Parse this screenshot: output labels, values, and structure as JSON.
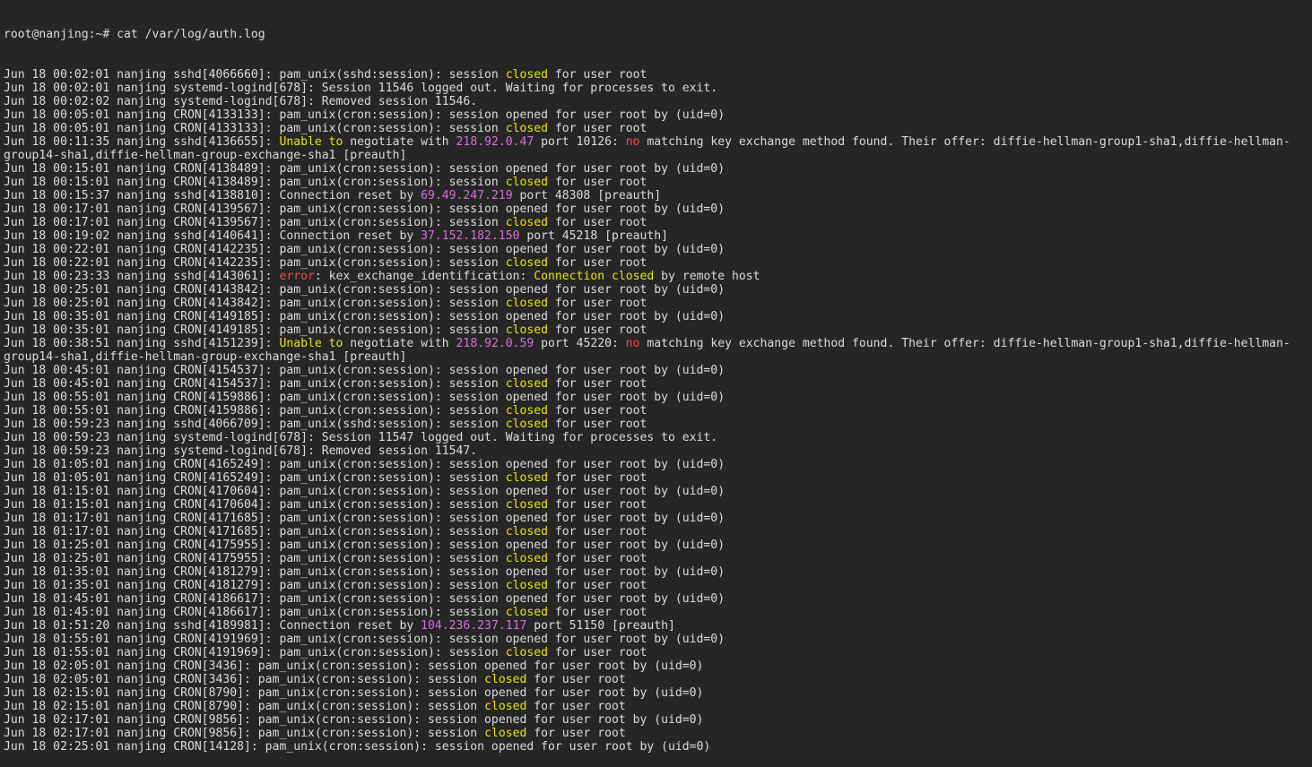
{
  "terminal": {
    "prompt": "root@nanjing:~# ",
    "command": "cat /var/log/auth.log",
    "colors": {
      "background": "#262626",
      "text": "#dcdcdc",
      "keyword_closed": "#e5e510",
      "ip_address": "#d670d6",
      "error": "#f14c4c"
    },
    "lines": [
      [
        {
          "t": "Jun 18 00:02:01 nanjing sshd[4066660]: pam_unix(sshd:session): session "
        },
        {
          "t": "closed",
          "c": "closed"
        },
        {
          "t": " for user root"
        }
      ],
      [
        {
          "t": "Jun 18 00:02:01 nanjing systemd-logind[678]: Session 11546 logged out. Waiting for processes to exit."
        }
      ],
      [
        {
          "t": "Jun 18 00:02:02 nanjing systemd-logind[678]: Removed session 11546."
        }
      ],
      [
        {
          "t": "Jun 18 00:05:01 nanjing CRON[4133133]: pam_unix(cron:session): session opened for user root by (uid=0)"
        }
      ],
      [
        {
          "t": "Jun 18 00:05:01 nanjing CRON[4133133]: pam_unix(cron:session): session "
        },
        {
          "t": "closed",
          "c": "closed"
        },
        {
          "t": " for user root"
        }
      ],
      [
        {
          "t": "Jun 18 00:11:35 nanjing sshd[4136655]: "
        },
        {
          "t": "Unable to",
          "c": "warn"
        },
        {
          "t": " negotiate with "
        },
        {
          "t": "218.92.0.47",
          "c": "ip"
        },
        {
          "t": " port 10126: "
        },
        {
          "t": "no",
          "c": "err"
        },
        {
          "t": " matching key exchange method found. Their offer: diffie-hellman-group1-sha1,diffie-hellman-"
        }
      ],
      [
        {
          "t": "group14-sha1,diffie-hellman-group-exchange-sha1 [preauth]"
        }
      ],
      [
        {
          "t": "Jun 18 00:15:01 nanjing CRON[4138489]: pam_unix(cron:session): session opened for user root by (uid=0)"
        }
      ],
      [
        {
          "t": "Jun 18 00:15:01 nanjing CRON[4138489]: pam_unix(cron:session): session "
        },
        {
          "t": "closed",
          "c": "closed"
        },
        {
          "t": " for user root"
        }
      ],
      [
        {
          "t": "Jun 18 00:15:37 nanjing sshd[4138810]: Connection reset by "
        },
        {
          "t": "69.49.247.219",
          "c": "ip"
        },
        {
          "t": " port 48308 [preauth]"
        }
      ],
      [
        {
          "t": "Jun 18 00:17:01 nanjing CRON[4139567]: pam_unix(cron:session): session opened for user root by (uid=0)"
        }
      ],
      [
        {
          "t": "Jun 18 00:17:01 nanjing CRON[4139567]: pam_unix(cron:session): session "
        },
        {
          "t": "closed",
          "c": "closed"
        },
        {
          "t": " for user root"
        }
      ],
      [
        {
          "t": "Jun 18 00:19:02 nanjing sshd[4140641]: Connection reset by "
        },
        {
          "t": "37.152.182.150",
          "c": "ip"
        },
        {
          "t": " port 45218 [preauth]"
        }
      ],
      [
        {
          "t": "Jun 18 00:22:01 nanjing CRON[4142235]: pam_unix(cron:session): session opened for user root by (uid=0)"
        }
      ],
      [
        {
          "t": "Jun 18 00:22:01 nanjing CRON[4142235]: pam_unix(cron:session): session "
        },
        {
          "t": "closed",
          "c": "closed"
        },
        {
          "t": " for user root"
        }
      ],
      [
        {
          "t": "Jun 18 00:23:33 nanjing sshd[4143061]: "
        },
        {
          "t": "error",
          "c": "err"
        },
        {
          "t": ": kex_exchange_identification: "
        },
        {
          "t": "Connection closed",
          "c": "closed"
        },
        {
          "t": " by remote host"
        }
      ],
      [
        {
          "t": "Jun 18 00:25:01 nanjing CRON[4143842]: pam_unix(cron:session): session opened for user root by (uid=0)"
        }
      ],
      [
        {
          "t": "Jun 18 00:25:01 nanjing CRON[4143842]: pam_unix(cron:session): session "
        },
        {
          "t": "closed",
          "c": "closed"
        },
        {
          "t": " for user root"
        }
      ],
      [
        {
          "t": "Jun 18 00:35:01 nanjing CRON[4149185]: pam_unix(cron:session): session opened for user root by (uid=0)"
        }
      ],
      [
        {
          "t": "Jun 18 00:35:01 nanjing CRON[4149185]: pam_unix(cron:session): session "
        },
        {
          "t": "closed",
          "c": "closed"
        },
        {
          "t": " for user root"
        }
      ],
      [
        {
          "t": "Jun 18 00:38:51 nanjing sshd[4151239]: "
        },
        {
          "t": "Unable to",
          "c": "warn"
        },
        {
          "t": " negotiate with "
        },
        {
          "t": "218.92.0.59",
          "c": "ip"
        },
        {
          "t": " port 45220: "
        },
        {
          "t": "no",
          "c": "err"
        },
        {
          "t": " matching key exchange method found. Their offer: diffie-hellman-group1-sha1,diffie-hellman-"
        }
      ],
      [
        {
          "t": "group14-sha1,diffie-hellman-group-exchange-sha1 [preauth]"
        }
      ],
      [
        {
          "t": "Jun 18 00:45:01 nanjing CRON[4154537]: pam_unix(cron:session): session opened for user root by (uid=0)"
        }
      ],
      [
        {
          "t": "Jun 18 00:45:01 nanjing CRON[4154537]: pam_unix(cron:session): session "
        },
        {
          "t": "closed",
          "c": "closed"
        },
        {
          "t": " for user root"
        }
      ],
      [
        {
          "t": "Jun 18 00:55:01 nanjing CRON[4159886]: pam_unix(cron:session): session opened for user root by (uid=0)"
        }
      ],
      [
        {
          "t": "Jun 18 00:55:01 nanjing CRON[4159886]: pam_unix(cron:session): session "
        },
        {
          "t": "closed",
          "c": "closed"
        },
        {
          "t": " for user root"
        }
      ],
      [
        {
          "t": "Jun 18 00:59:23 nanjing sshd[4066709]: pam_unix(sshd:session): session "
        },
        {
          "t": "closed",
          "c": "closed"
        },
        {
          "t": " for user root"
        }
      ],
      [
        {
          "t": "Jun 18 00:59:23 nanjing systemd-logind[678]: Session 11547 logged out. Waiting for processes to exit."
        }
      ],
      [
        {
          "t": "Jun 18 00:59:23 nanjing systemd-logind[678]: Removed session 11547."
        }
      ],
      [
        {
          "t": "Jun 18 01:05:01 nanjing CRON[4165249]: pam_unix(cron:session): session opened for user root by (uid=0)"
        }
      ],
      [
        {
          "t": "Jun 18 01:05:01 nanjing CRON[4165249]: pam_unix(cron:session): session "
        },
        {
          "t": "closed",
          "c": "closed"
        },
        {
          "t": " for user root"
        }
      ],
      [
        {
          "t": "Jun 18 01:15:01 nanjing CRON[4170604]: pam_unix(cron:session): session opened for user root by (uid=0)"
        }
      ],
      [
        {
          "t": "Jun 18 01:15:01 nanjing CRON[4170604]: pam_unix(cron:session): session "
        },
        {
          "t": "closed",
          "c": "closed"
        },
        {
          "t": " for user root"
        }
      ],
      [
        {
          "t": "Jun 18 01:17:01 nanjing CRON[4171685]: pam_unix(cron:session): session opened for user root by (uid=0)"
        }
      ],
      [
        {
          "t": "Jun 18 01:17:01 nanjing CRON[4171685]: pam_unix(cron:session): session "
        },
        {
          "t": "closed",
          "c": "closed"
        },
        {
          "t": " for user root"
        }
      ],
      [
        {
          "t": "Jun 18 01:25:01 nanjing CRON[4175955]: pam_unix(cron:session): session opened for user root by (uid=0)"
        }
      ],
      [
        {
          "t": "Jun 18 01:25:01 nanjing CRON[4175955]: pam_unix(cron:session): session "
        },
        {
          "t": "closed",
          "c": "closed"
        },
        {
          "t": " for user root"
        }
      ],
      [
        {
          "t": "Jun 18 01:35:01 nanjing CRON[4181279]: pam_unix(cron:session): session opened for user root by (uid=0)"
        }
      ],
      [
        {
          "t": "Jun 18 01:35:01 nanjing CRON[4181279]: pam_unix(cron:session): session "
        },
        {
          "t": "closed",
          "c": "closed"
        },
        {
          "t": " for user root"
        }
      ],
      [
        {
          "t": "Jun 18 01:45:01 nanjing CRON[4186617]: pam_unix(cron:session): session opened for user root by (uid=0)"
        }
      ],
      [
        {
          "t": "Jun 18 01:45:01 nanjing CRON[4186617]: pam_unix(cron:session): session "
        },
        {
          "t": "closed",
          "c": "closed"
        },
        {
          "t": " for user root"
        }
      ],
      [
        {
          "t": "Jun 18 01:51:20 nanjing sshd[4189981]: Connection reset by "
        },
        {
          "t": "104.236.237.117",
          "c": "ip"
        },
        {
          "t": " port 51150 [preauth]"
        }
      ],
      [
        {
          "t": "Jun 18 01:55:01 nanjing CRON[4191969]: pam_unix(cron:session): session opened for user root by (uid=0)"
        }
      ],
      [
        {
          "t": "Jun 18 01:55:01 nanjing CRON[4191969]: pam_unix(cron:session): session "
        },
        {
          "t": "closed",
          "c": "closed"
        },
        {
          "t": " for user root"
        }
      ],
      [
        {
          "t": "Jun 18 02:05:01 nanjing CRON[3436]: pam_unix(cron:session): session opened for user root by (uid=0)"
        }
      ],
      [
        {
          "t": "Jun 18 02:05:01 nanjing CRON[3436]: pam_unix(cron:session): session "
        },
        {
          "t": "closed",
          "c": "closed"
        },
        {
          "t": " for user root"
        }
      ],
      [
        {
          "t": "Jun 18 02:15:01 nanjing CRON[8790]: pam_unix(cron:session): session opened for user root by (uid=0)"
        }
      ],
      [
        {
          "t": "Jun 18 02:15:01 nanjing CRON[8790]: pam_unix(cron:session): session "
        },
        {
          "t": "closed",
          "c": "closed"
        },
        {
          "t": " for user root"
        }
      ],
      [
        {
          "t": "Jun 18 02:17:01 nanjing CRON[9856]: pam_unix(cron:session): session opened for user root by (uid=0)"
        }
      ],
      [
        {
          "t": "Jun 18 02:17:01 nanjing CRON[9856]: pam_unix(cron:session): session "
        },
        {
          "t": "closed",
          "c": "closed"
        },
        {
          "t": " for user root"
        }
      ],
      [
        {
          "t": "Jun 18 02:25:01 nanjing CRON[14128]: pam_unix(cron:session): session opened for user root by (uid=0)"
        }
      ]
    ]
  }
}
